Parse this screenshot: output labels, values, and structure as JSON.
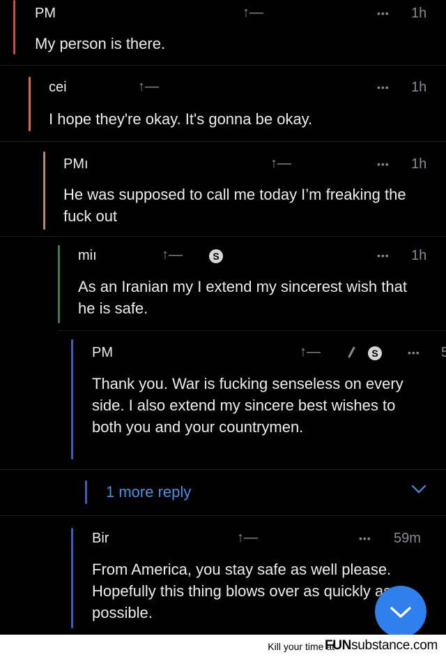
{
  "comments": [
    {
      "author": "PM",
      "votes": "↑—",
      "time": "1h",
      "body": "My person is there.",
      "bar_color": "#d9534f"
    },
    {
      "author": "cei",
      "votes": "↑—",
      "time": "1h",
      "body": "I hope they're okay. It's gonna be okay.",
      "bar_color": "#e07a3f"
    },
    {
      "author": "PMı",
      "votes": "↑—",
      "time": "1h",
      "body": "He was supposed to call me today I’m freaking the fuck out",
      "bar_color": "#c9905a"
    },
    {
      "author": "miı",
      "votes": "↑—",
      "time": "1h",
      "body": "As an Iranian my I extend my sincerest wish that he is safe.",
      "bar_color": "#3f8c4f",
      "badge": "S"
    },
    {
      "author": "PM",
      "votes": "↑—",
      "time": "5",
      "body": "Thank you. War is fucking senseless on every side. I also extend my sincere best wishes to both you and your countrymen.",
      "bar_color": "#3a5fbf",
      "badge": "S",
      "icons": [
        "pencil-icon"
      ]
    },
    {
      "author": "Bir",
      "votes": "↑—",
      "time": "59m",
      "body": "From America, you stay safe as well please. Hopefully this thing blows over as quickly as possible.",
      "bar_color": "#3a5fbf"
    }
  ],
  "more_replies": {
    "label": "1 more reply",
    "bar_color": "#3a5fbf"
  },
  "dots_glyph": "•••",
  "footer": {
    "left": "Kill your time at",
    "brand_bold": "FUN",
    "brand_rest": "substance",
    "brand_tld": ".com"
  },
  "colors": {
    "background": "#000000",
    "link": "#4a90e2",
    "fab": "#2f80ed"
  }
}
